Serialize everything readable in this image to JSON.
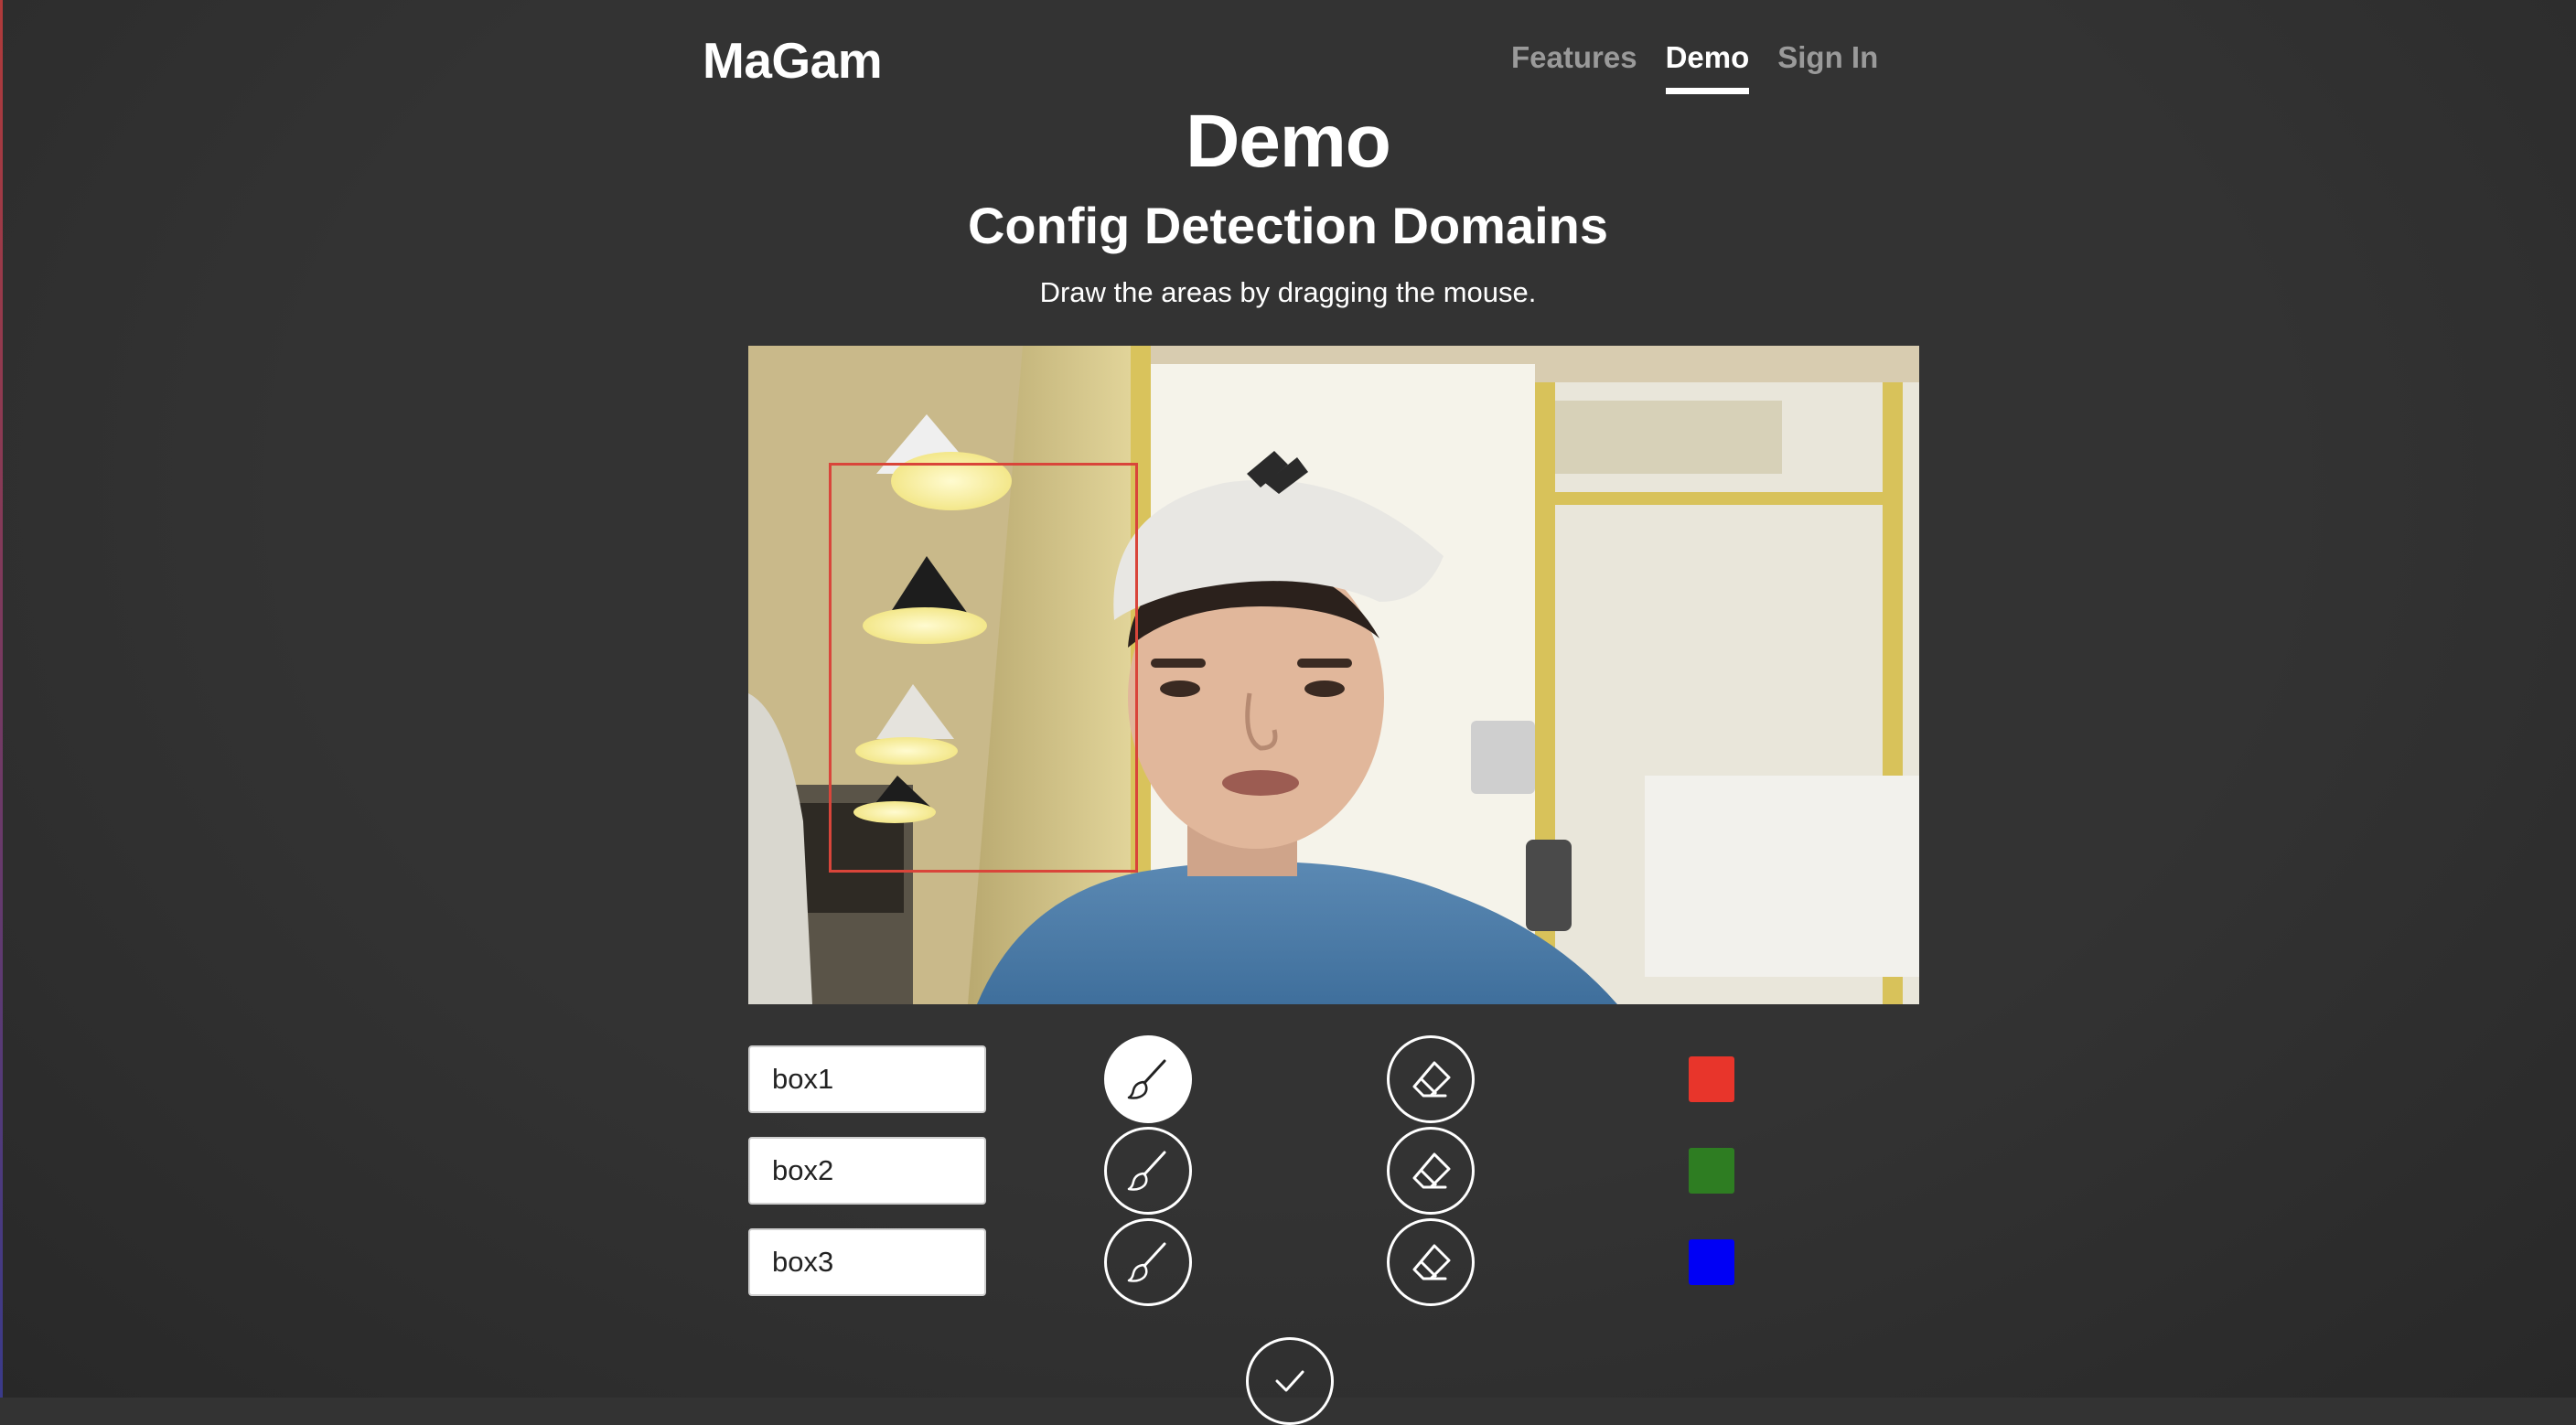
{
  "header": {
    "brand": "MaGam",
    "nav": [
      {
        "label": "Features",
        "active": false
      },
      {
        "label": "Demo",
        "active": true
      },
      {
        "label": "Sign In",
        "active": false
      }
    ]
  },
  "page": {
    "title": "Demo",
    "section_title": "Config Detection Domains",
    "instructions": "Draw the areas by dragging the mouse."
  },
  "camera": {
    "description_icon": "webcam-feed",
    "box_color": "#d9453a"
  },
  "boxes": [
    {
      "name": "box1",
      "color": "#e8352b",
      "brush_selected": true,
      "brush_icon": "brush-icon",
      "eraser_icon": "eraser-icon"
    },
    {
      "name": "box2",
      "color": "#2e7d22",
      "brush_selected": false,
      "brush_icon": "brush-icon",
      "eraser_icon": "eraser-icon"
    },
    {
      "name": "box3",
      "color": "#0000f5",
      "brush_selected": false,
      "brush_icon": "brush-icon",
      "eraser_icon": "eraser-icon"
    }
  ],
  "confirm_icon": "check-icon",
  "colors": {
    "background": "#333333",
    "text": "#ffffff",
    "nav_inactive": "#9a9a9a"
  }
}
